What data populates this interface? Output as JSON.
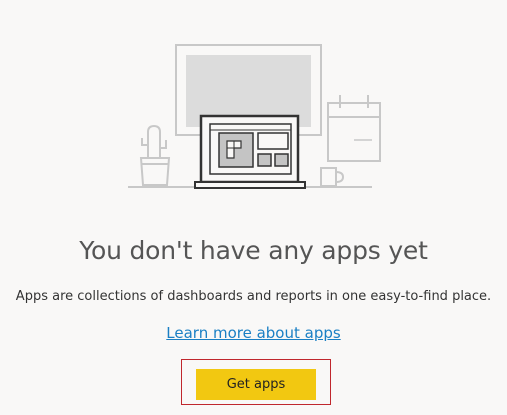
{
  "empty_state": {
    "title": "You don't have any apps yet",
    "description": "Apps are collections of dashboards and reports in one easy-to-find place.",
    "learn_more_link": "Learn more about apps",
    "get_apps_button": "Get apps",
    "accent_color": "#f2c811",
    "link_color": "#1a7fc4",
    "highlight_color": "#c0272d"
  }
}
